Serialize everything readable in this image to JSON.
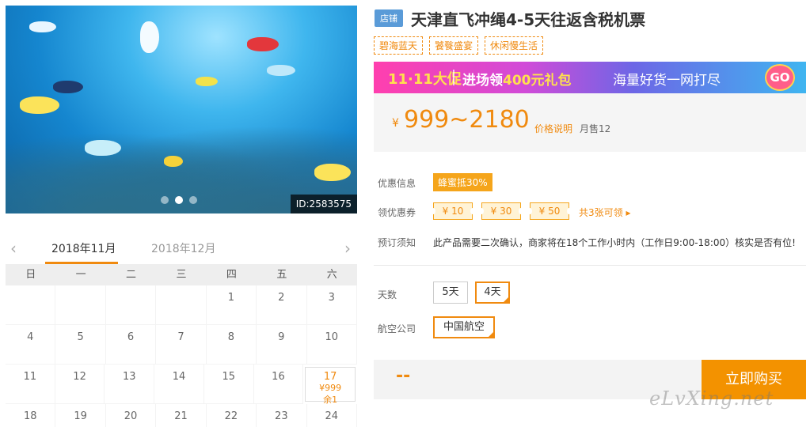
{
  "gallery": {
    "image_id": "ID:2583575",
    "slide_count": 3,
    "active_slide": 1
  },
  "calendar": {
    "months": [
      "2018年11月",
      "2018年12月"
    ],
    "active_month_index": 0,
    "weekdays": [
      "日",
      "一",
      "二",
      "三",
      "四",
      "五",
      "六"
    ],
    "rows": [
      [
        "",
        "",
        "",
        "",
        "1",
        "2",
        "3"
      ],
      [
        "4",
        "5",
        "6",
        "7",
        "8",
        "9",
        "10"
      ],
      [
        "11",
        "12",
        "13",
        "14",
        "15",
        "16",
        "17"
      ],
      [
        "18",
        "19",
        "20",
        "21",
        "22",
        "23",
        "24"
      ]
    ],
    "selected_day": {
      "day": "17",
      "price": "¥999",
      "remaining": "余1"
    }
  },
  "product": {
    "shop_badge": "店铺",
    "title": "天津直飞冲绳4-5天往返含税机票",
    "tags": [
      "碧海蓝天",
      "饕餮盛宴",
      "休闲慢生活"
    ]
  },
  "banner": {
    "logo": "11·11大促",
    "mid_prefix": "进场领",
    "mid_highlight": "400元礼包",
    "right": "海量好货一网打尽",
    "go": "GO"
  },
  "price": {
    "currency": "¥",
    "range": "999~2180",
    "explain": "价格说明",
    "monthly_sales": "月售12"
  },
  "promo": {
    "label": "优惠信息",
    "badge": "蜂蜜抵30%",
    "coupon_label": "领优惠券",
    "coupons": [
      "¥ 10",
      "¥ 30",
      "¥ 50"
    ],
    "coupon_more": "共3张可领 ▸",
    "notice_label": "预订须知",
    "notice": "此产品需要二次确认，商家将在18个工作小时内（工作日9:00-18:00）核实是否有位!"
  },
  "options": {
    "days_label": "天数",
    "days": [
      "5天",
      "4天"
    ],
    "days_selected": 1,
    "airline_label": "航空公司",
    "airlines": [
      "中国航空"
    ],
    "airline_selected": 0
  },
  "buy": {
    "price": "--",
    "button": "立即购买"
  },
  "watermark": "eLvXing.net"
}
